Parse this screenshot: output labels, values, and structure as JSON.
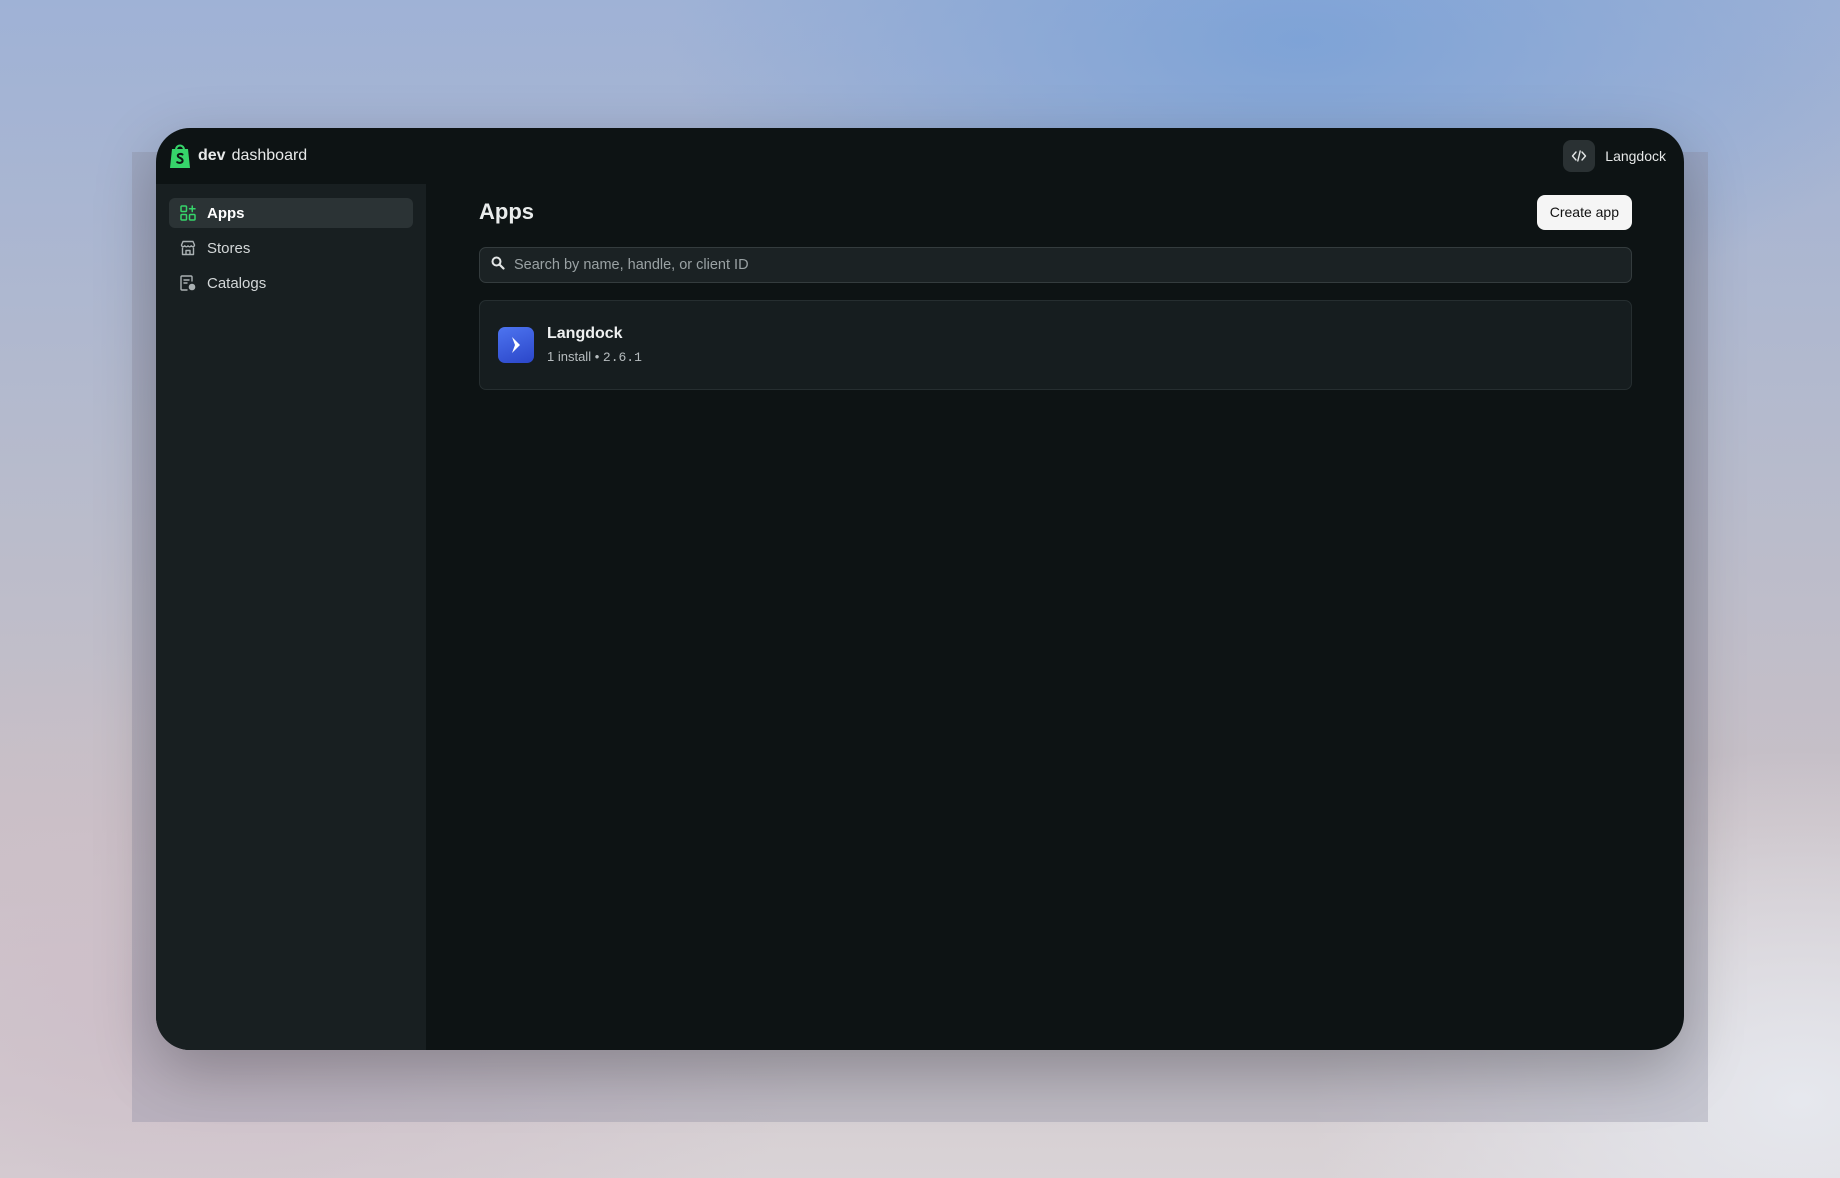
{
  "brand": {
    "bold": "dev",
    "rest": "dashboard"
  },
  "account": {
    "name": "Langdock"
  },
  "sidebar": {
    "items": [
      {
        "label": "Apps",
        "icon": "apps-grid-icon",
        "active": true
      },
      {
        "label": "Stores",
        "icon": "store-icon",
        "active": false
      },
      {
        "label": "Catalogs",
        "icon": "catalog-icon",
        "active": false
      }
    ]
  },
  "main": {
    "title": "Apps",
    "create_button": "Create app",
    "search": {
      "placeholder": "Search by name, handle, or client ID",
      "value": ""
    },
    "apps": [
      {
        "name": "Langdock",
        "installs": "1 install",
        "separator": "•",
        "version": "2.6.1"
      }
    ]
  },
  "colors": {
    "accent_green": "#36d46a",
    "app_icon_blue": "#3457de",
    "window_bg": "#0d1314",
    "sidebar_bg": "#181f21"
  }
}
